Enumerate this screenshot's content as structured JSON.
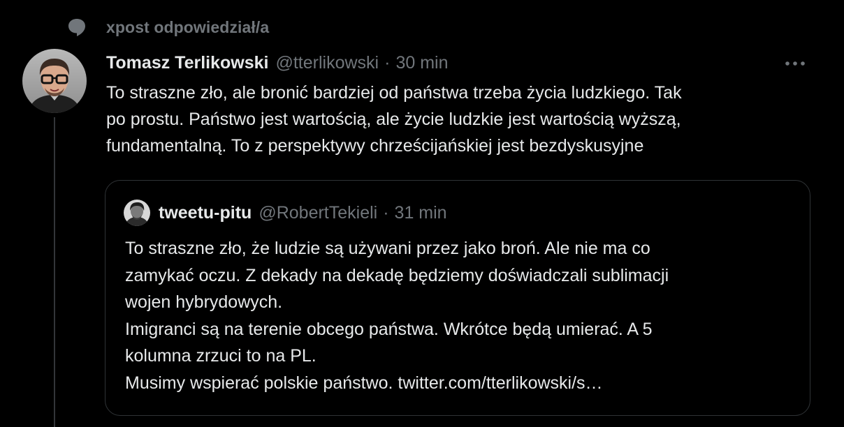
{
  "social_context": {
    "icon": "reply-bubble-icon",
    "text": "xpost odpowiedział/a"
  },
  "tweet": {
    "display_name": "Tomasz Terlikowski",
    "handle": "@tterlikowski",
    "separator": "·",
    "time": "30 min",
    "more_icon": "more-dots-icon",
    "text_lines": [
      "To straszne zło, ale bronić bardziej od państwa trzeba życia ludzkiego. Tak",
      "po prostu. Państwo jest wartością, ale życie ludzkie jest wartością wyższą,",
      "fundamentalną. To z perspektywy chrześcijańskiej jest bezdyskusyjne"
    ]
  },
  "quote": {
    "display_name": "tweetu-pitu",
    "handle": "@RobertTekieli",
    "separator": "·",
    "time": "31 min",
    "text_lines": [
      "To straszne zło, że ludzie są używani przez jako broń. Ale nie ma co",
      "zamykać oczu. Z dekady na dekadę będziemy doświadczali sublimacji",
      "wojen hybrydowych.",
      "Imigranci są na terenie obcego państwa. Wkrótce będą umierać. A 5",
      "kolumna zrzuci to na PL.",
      "Musimy wspierać polskie państwo. twitter.com/tterlikowski/s…"
    ]
  },
  "colors": {
    "background": "#000000",
    "primary_text": "#e7e9ea",
    "secondary_text": "#71767b",
    "border": "#2f3336"
  }
}
